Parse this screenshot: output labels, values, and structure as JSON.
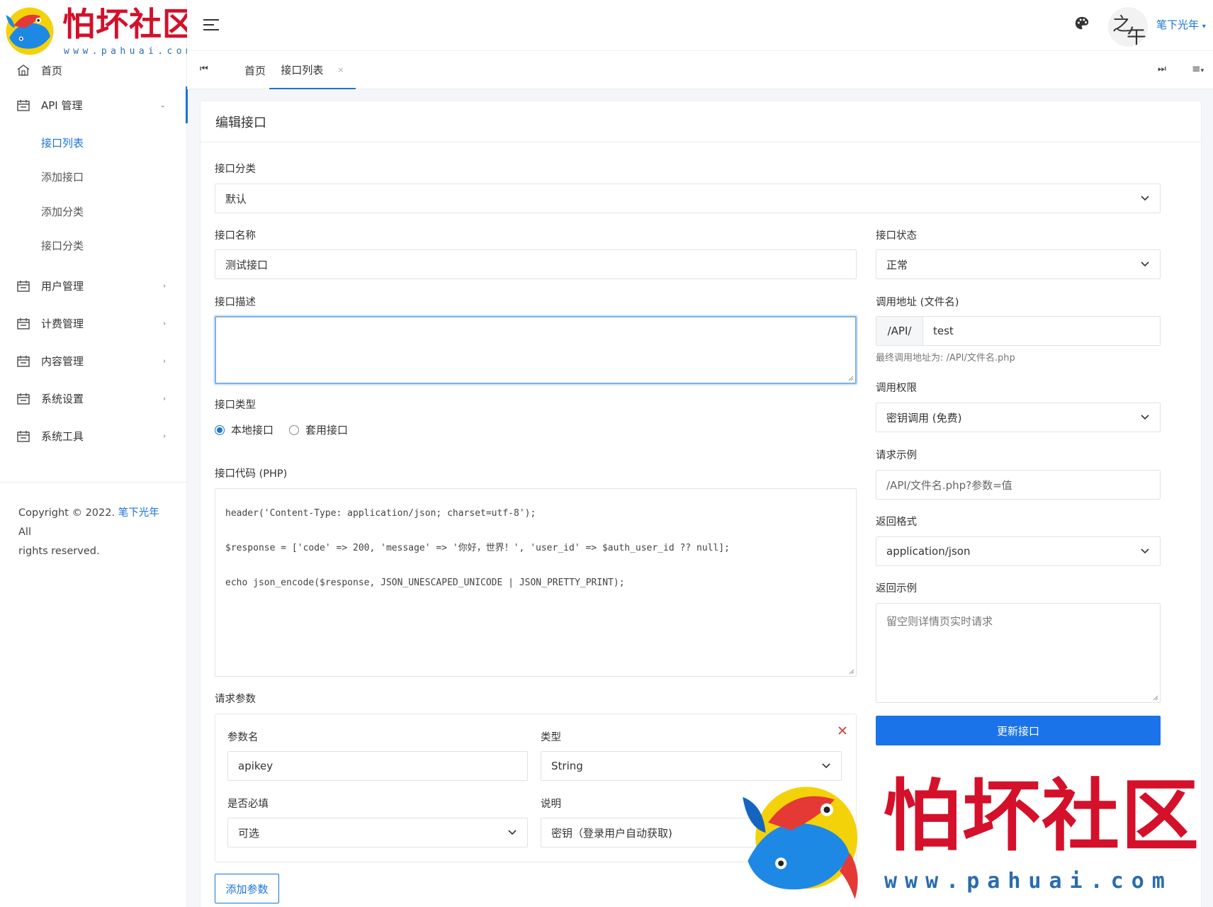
{
  "brand": {
    "name": "怕坏社区",
    "url": "www.pahuai.com"
  },
  "header": {
    "user_name": "笔下光年",
    "avatar_text_1": "之",
    "avatar_text_2": "午"
  },
  "sidebar": {
    "home_label": "首页",
    "api_group": {
      "label": "API 管理",
      "items": [
        {
          "label": "接口列表",
          "active": true
        },
        {
          "label": "添加接口"
        },
        {
          "label": "添加分类"
        },
        {
          "label": "接口分类"
        }
      ]
    },
    "groups": [
      {
        "label": "用户管理"
      },
      {
        "label": "计费管理"
      },
      {
        "label": "内容管理"
      },
      {
        "label": "系统设置"
      },
      {
        "label": "系统工具"
      }
    ],
    "footer": {
      "prefix": "Copyright © 2022.",
      "link": "笔下光年",
      "suffix": "All",
      "line2": "rights reserved."
    }
  },
  "tabs": {
    "items": [
      {
        "label": "首页"
      },
      {
        "label": "接口列表",
        "active": true
      }
    ],
    "close_glyph": "×"
  },
  "form": {
    "title": "编辑接口",
    "category": {
      "label": "接口分类",
      "value": "默认"
    },
    "name": {
      "label": "接口名称",
      "value": "测试接口"
    },
    "status": {
      "label": "接口状态",
      "value": "正常"
    },
    "description": {
      "label": "接口描述",
      "value": ""
    },
    "call_url": {
      "label": "调用地址 (文件名)",
      "prefix": "/API/",
      "value": "test",
      "help": "最终调用地址为: /API/文件名.php"
    },
    "type": {
      "label": "接口类型",
      "options": [
        {
          "label": "本地接口",
          "checked": true
        },
        {
          "label": "套用接口",
          "checked": false
        }
      ]
    },
    "permission": {
      "label": "调用权限",
      "value": "密钥调用 (免费)"
    },
    "request_example": {
      "label": "请求示例",
      "placeholder": "/API/文件名.php?参数=值"
    },
    "code": {
      "label": "接口代码 (PHP)",
      "lines": [
        "header('Content-Type: application/json; charset=utf-8');",
        "$response = ['code' => 200, 'message' => '你好，世界！', 'user_id' => $auth_user_id ?? null];",
        "echo json_encode($response, JSON_UNESCAPED_UNICODE | JSON_PRETTY_PRINT);"
      ]
    },
    "return_format": {
      "label": "返回格式",
      "value": "application/json"
    },
    "return_example": {
      "label": "返回示例",
      "placeholder": "留空则详情页实时请求"
    },
    "params": {
      "label": "请求参数",
      "name_label": "参数名",
      "name_value": "apikey",
      "type_label": "类型",
      "type_value": "String",
      "required_label": "是否必填",
      "required_value": "可选",
      "desc_label": "说明",
      "desc_value": "密钥（登录用户自动获取)"
    },
    "add_param_button": "添加参数",
    "submit_button": "更新接口"
  },
  "watermark": {
    "name": "怕坏社区",
    "url": "www.pahuai.com"
  },
  "colors": {
    "primary": "#1a73e8",
    "brand_red": "#d4102a",
    "brand_blue": "#2b6cb0",
    "fish_yellow": "#f4d20a",
    "fish_blue": "#1e88e5"
  }
}
